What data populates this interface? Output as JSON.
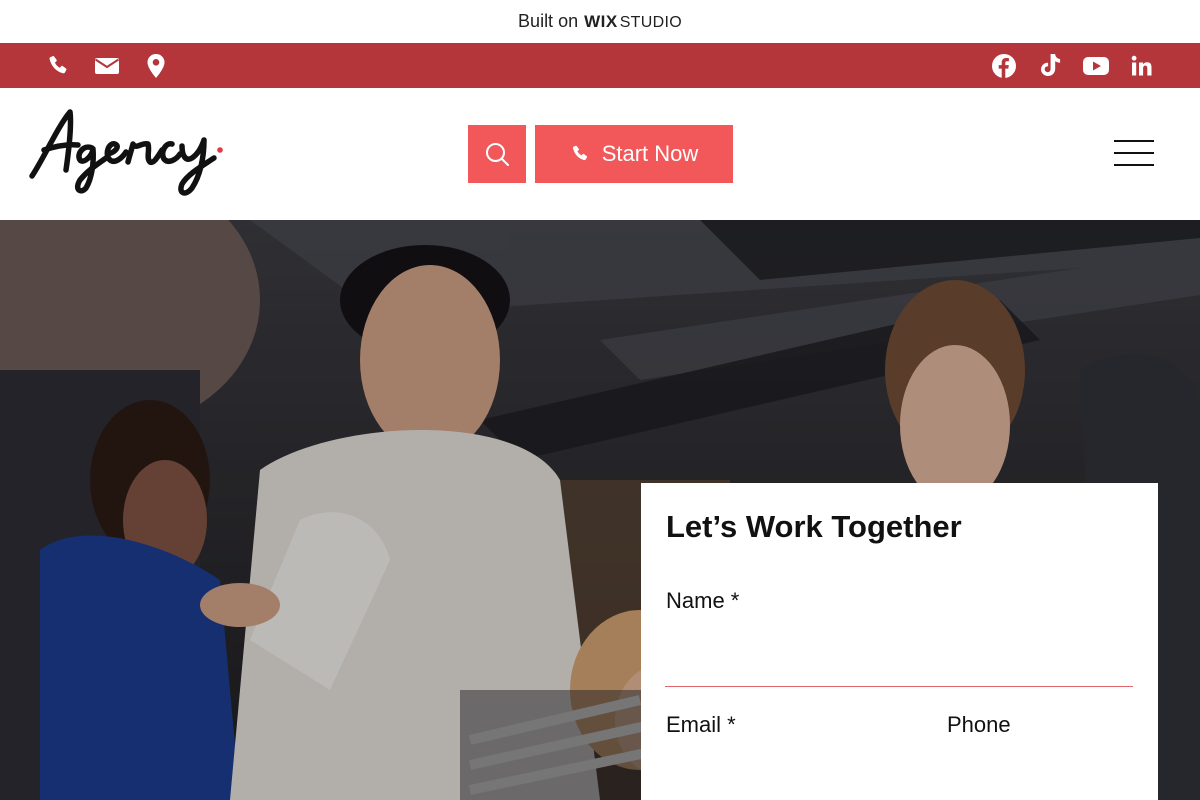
{
  "wix_banner": {
    "prefix": "Built on",
    "brand": "WIX",
    "product": "STUDIO"
  },
  "contact_bar": {
    "background": "#b5363a",
    "left_icons": [
      "phone-icon",
      "envelope-icon",
      "map-pin-icon"
    ],
    "right_icons": [
      "facebook-icon",
      "tiktok-icon",
      "youtube-icon",
      "linkedin-icon"
    ]
  },
  "header": {
    "logo_text": "Agency",
    "accent": "#f2585a",
    "search_icon": "search-icon",
    "cta_label": "Start Now",
    "menu_icon": "hamburger-icon"
  },
  "hero": {
    "image": "team-working-together-photo"
  },
  "form": {
    "title": "Let’s Work Together",
    "name_label": "Name *",
    "email_label": "Email *",
    "phone_label": "Phone",
    "name_value": "",
    "email_value": "",
    "phone_value": ""
  }
}
